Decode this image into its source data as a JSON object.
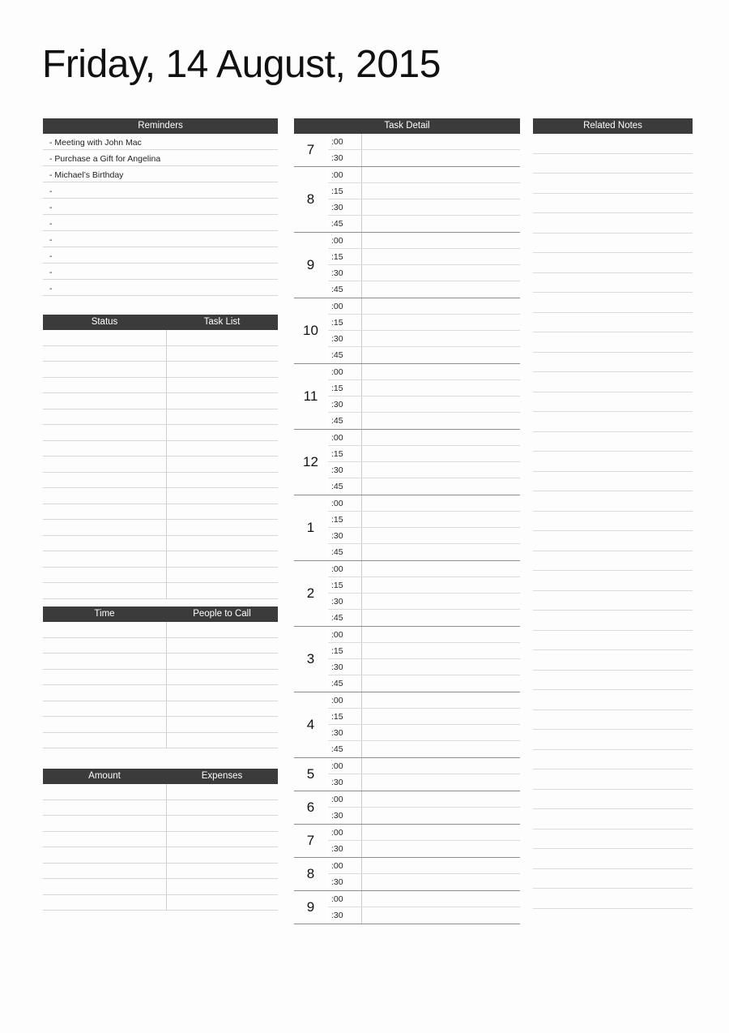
{
  "document": {
    "title": "Friday, 14 August, 2015",
    "type": "daily-planner",
    "accent_color": "#3b3b3b",
    "rule_color": "#d8d8d8",
    "background_color": "#fdfdfd"
  },
  "reminders": {
    "header": "Reminders",
    "items": [
      "- Meeting with John Mac",
      "- Purchase a Gift for Angelina",
      "- Michael’s Birthday",
      "-",
      "-",
      "-",
      "-",
      "-",
      "-",
      "-"
    ]
  },
  "task_list": {
    "header_left": "Status",
    "header_right": "Task List",
    "row_count": 17,
    "rows": [
      {
        "status": "",
        "task": ""
      },
      {
        "status": "",
        "task": ""
      },
      {
        "status": "",
        "task": ""
      },
      {
        "status": "",
        "task": ""
      },
      {
        "status": "",
        "task": ""
      },
      {
        "status": "",
        "task": ""
      },
      {
        "status": "",
        "task": ""
      },
      {
        "status": "",
        "task": ""
      },
      {
        "status": "",
        "task": ""
      },
      {
        "status": "",
        "task": ""
      },
      {
        "status": "",
        "task": ""
      },
      {
        "status": "",
        "task": ""
      },
      {
        "status": "",
        "task": ""
      },
      {
        "status": "",
        "task": ""
      },
      {
        "status": "",
        "task": ""
      },
      {
        "status": "",
        "task": ""
      },
      {
        "status": "",
        "task": ""
      }
    ]
  },
  "people_to_call": {
    "header_left": "Time",
    "header_right": "People to Call",
    "row_count": 8,
    "rows": [
      {
        "time": "",
        "person": ""
      },
      {
        "time": "",
        "person": ""
      },
      {
        "time": "",
        "person": ""
      },
      {
        "time": "",
        "person": ""
      },
      {
        "time": "",
        "person": ""
      },
      {
        "time": "",
        "person": ""
      },
      {
        "time": "",
        "person": ""
      },
      {
        "time": "",
        "person": ""
      }
    ]
  },
  "expenses": {
    "header_left": "Amount",
    "header_right": "Expenses",
    "row_count": 8,
    "rows": [
      {
        "amount": "",
        "expense": ""
      },
      {
        "amount": "",
        "expense": ""
      },
      {
        "amount": "",
        "expense": ""
      },
      {
        "amount": "",
        "expense": ""
      },
      {
        "amount": "",
        "expense": ""
      },
      {
        "amount": "",
        "expense": ""
      },
      {
        "amount": "",
        "expense": ""
      },
      {
        "amount": "",
        "expense": ""
      }
    ]
  },
  "task_detail": {
    "header": "Task Detail",
    "hours": [
      {
        "hour": "7",
        "slots": [
          ":00",
          ":30"
        ],
        "entries": [
          "",
          ""
        ]
      },
      {
        "hour": "8",
        "slots": [
          ":00",
          ":15",
          ":30",
          ":45"
        ],
        "entries": [
          "",
          "",
          "",
          ""
        ]
      },
      {
        "hour": "9",
        "slots": [
          ":00",
          ":15",
          ":30",
          ":45"
        ],
        "entries": [
          "",
          "",
          "",
          ""
        ]
      },
      {
        "hour": "10",
        "slots": [
          ":00",
          ":15",
          ":30",
          ":45"
        ],
        "entries": [
          "",
          "",
          "",
          ""
        ]
      },
      {
        "hour": "11",
        "slots": [
          ":00",
          ":15",
          ":30",
          ":45"
        ],
        "entries": [
          "",
          "",
          "",
          ""
        ]
      },
      {
        "hour": "12",
        "slots": [
          ":00",
          ":15",
          ":30",
          ":45"
        ],
        "entries": [
          "",
          "",
          "",
          ""
        ]
      },
      {
        "hour": "1",
        "slots": [
          ":00",
          ":15",
          ":30",
          ":45"
        ],
        "entries": [
          "",
          "",
          "",
          ""
        ]
      },
      {
        "hour": "2",
        "slots": [
          ":00",
          ":15",
          ":30",
          ":45"
        ],
        "entries": [
          "",
          "",
          "",
          ""
        ]
      },
      {
        "hour": "3",
        "slots": [
          ":00",
          ":15",
          ":30",
          ":45"
        ],
        "entries": [
          "",
          "",
          "",
          ""
        ]
      },
      {
        "hour": "4",
        "slots": [
          ":00",
          ":15",
          ":30",
          ":45"
        ],
        "entries": [
          "",
          "",
          "",
          ""
        ]
      },
      {
        "hour": "5",
        "slots": [
          ":00",
          ":30"
        ],
        "entries": [
          "",
          ""
        ]
      },
      {
        "hour": "6",
        "slots": [
          ":00",
          ":30"
        ],
        "entries": [
          "",
          ""
        ]
      },
      {
        "hour": "7",
        "slots": [
          ":00",
          ":30"
        ],
        "entries": [
          "",
          ""
        ]
      },
      {
        "hour": "8",
        "slots": [
          ":00",
          ":30"
        ],
        "entries": [
          "",
          ""
        ]
      },
      {
        "hour": "9",
        "slots": [
          ":00",
          ":30"
        ],
        "entries": [
          "",
          ""
        ]
      }
    ]
  },
  "related_notes": {
    "header": "Related Notes",
    "line_count": 39,
    "lines": []
  }
}
